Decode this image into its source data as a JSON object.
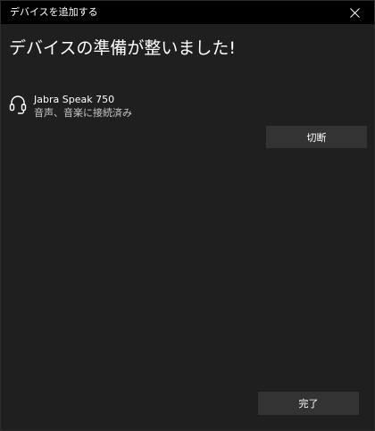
{
  "window": {
    "title": "デバイスを追加する",
    "close_icon": "close-icon"
  },
  "main": {
    "heading": "デバイスの準備が整いました!",
    "device": {
      "icon": "headset-icon",
      "name": "Jabra Speak 750",
      "status": "音声、音楽に接続済み",
      "disconnect_label": "切断"
    },
    "done_label": "完了"
  },
  "colors": {
    "background": "#1f1f1f",
    "titlebar": "#000000",
    "button": "#333333",
    "text": "#ffffff",
    "secondary_text": "#c8c8c8"
  }
}
